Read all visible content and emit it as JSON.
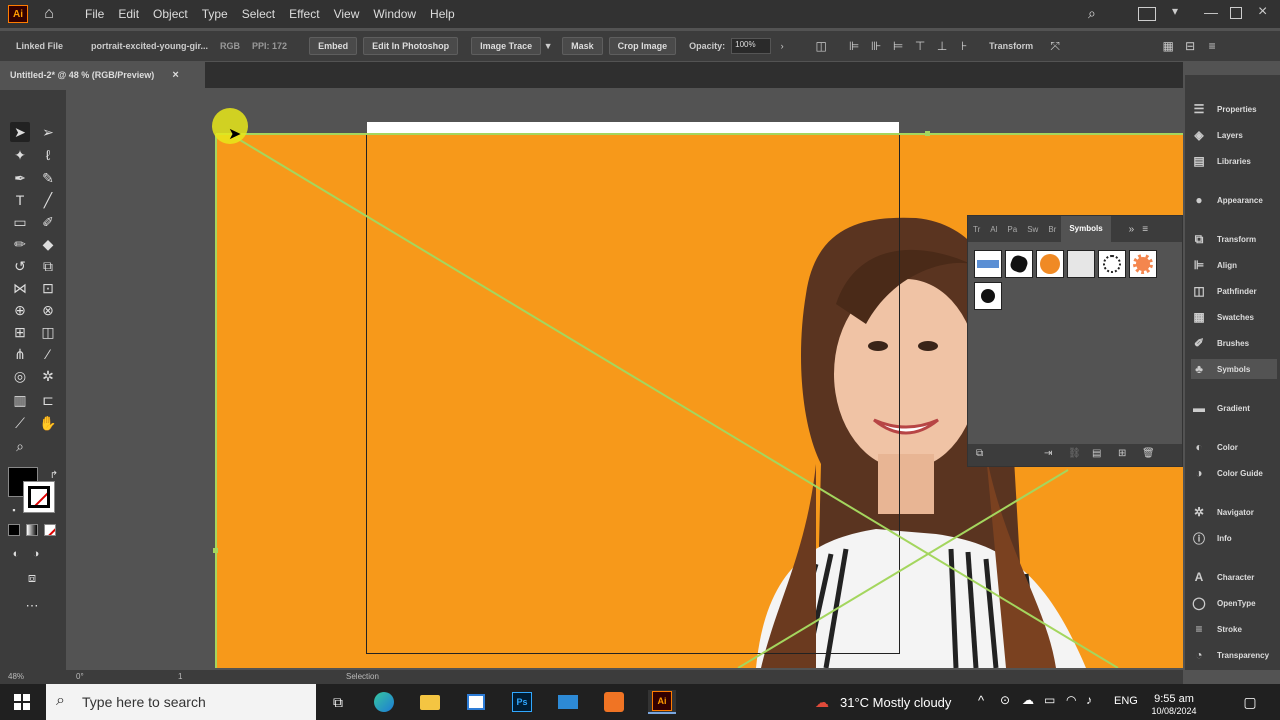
{
  "menubar": {
    "app_logo": "Ai",
    "items": [
      "File",
      "Edit",
      "Object",
      "Type",
      "Select",
      "Effect",
      "View",
      "Window",
      "Help"
    ]
  },
  "controlbar": {
    "linked_file": "Linked File",
    "filename": "portrait-excited-young-gir...",
    "color_mode": "RGB",
    "ppi": "PPI: 172",
    "embed": "Embed",
    "edit_photoshop": "Edit In Photoshop",
    "image_trace": "Image Trace",
    "mask": "Mask",
    "crop_image": "Crop Image",
    "opacity_label": "Opacity:",
    "opacity_value": "100%",
    "transform": "Transform"
  },
  "doc_tab": {
    "title": "Untitled-2* @ 48 % (RGB/Preview)",
    "close": "×"
  },
  "symbols_panel": {
    "tabs": [
      "Tr",
      "Al",
      "Pa",
      "Sw",
      "Br",
      "Symbols"
    ],
    "active_tab": "Symbols"
  },
  "right_panel": {
    "items": [
      "Properties",
      "Layers",
      "Libraries",
      "Appearance",
      "Transform",
      "Align",
      "Pathfinder",
      "Swatches",
      "Brushes",
      "Symbols",
      "Gradient",
      "Color",
      "Color Guide",
      "Navigator",
      "Info",
      "Character",
      "OpenType",
      "Stroke",
      "Transparency"
    ]
  },
  "statusbar": {
    "zoom": "48%",
    "rotation": "0°",
    "page": "1",
    "tool": "Selection"
  },
  "taskbar": {
    "search_placeholder": "Type here to search",
    "weather": "31°C  Mostly cloudy",
    "lang": "ENG",
    "time": "9:55 am",
    "date": "10/08/2024"
  },
  "colors": {
    "artboard": "#f7991a",
    "guide": "#a4d65e",
    "cursor_highlight": "#e8e81a"
  }
}
